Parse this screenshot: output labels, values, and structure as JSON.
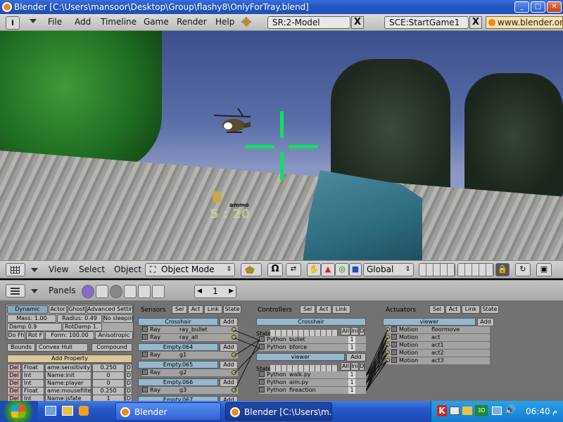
{
  "window": {
    "title": "Blender [C:\\Users\\mansoor\\Desktop\\Group\\flashy8\\OnlyForTray.blend]",
    "min_glyph": "_",
    "max_glyph": "□",
    "close_glyph": "✕"
  },
  "menu": {
    "items": [
      "File",
      "Add",
      "Timeline",
      "Game",
      "Render",
      "Help"
    ],
    "screen": "SR:2-Model",
    "scene": "SCE:StartGame1",
    "url": "www.blender.org",
    "close_glyph": "X"
  },
  "hud": {
    "ammo_label": "ammo",
    "ammo_value": "5 : 20"
  },
  "view_header": {
    "view": "View",
    "select": "Select",
    "object": "Object",
    "mode": "Object Mode",
    "orientation": "Global"
  },
  "buttons_header": {
    "panels": "Panels",
    "frame": "1"
  },
  "physics": {
    "tabs": [
      "Dynamic",
      "Actor",
      "Ghost",
      "Advanced Settings"
    ],
    "mass": "Mass: 1.00",
    "radius": "Radius: 0.49",
    "no_sleep": "No sleepin",
    "damp": "Damp 0.9",
    "rotdamp": "RotDamp 1.",
    "do_fh": "Do Fh",
    "rot_f": "Rot F",
    "form": "Form: 100.00",
    "aniso": "Anisotropic",
    "bounds": "Bounds",
    "bounds_type": "Convex Hull",
    "compound": "Compound",
    "add_property": "Add Property",
    "properties": [
      {
        "del": "Del",
        "type": "Float",
        "name": "ame:sensitivity",
        "value": "0.250",
        "d": "D"
      },
      {
        "del": "Del",
        "type": "Int",
        "name": "Name:init",
        "value": "0",
        "d": "D"
      },
      {
        "del": "Del",
        "type": "Int",
        "name": "Name:player",
        "value": "0",
        "d": "D"
      },
      {
        "del": "Del",
        "type": "Float",
        "name": "ame:mousefilter",
        "value": "0.250",
        "d": "D"
      },
      {
        "del": "Del",
        "type": "Int",
        "name": "Name:jsfate",
        "value": "1",
        "d": "D"
      }
    ]
  },
  "sensors": {
    "title": "Sensors",
    "filters": [
      "Sel",
      "Act",
      "Link",
      "State"
    ],
    "groups": [
      {
        "name": "Crosshair",
        "add": "Add",
        "rows": [
          {
            "type": "Ray",
            "name": "ray_bullet"
          },
          {
            "type": "Ray",
            "name": "ray_all"
          }
        ]
      },
      {
        "name": "Empty.064",
        "add": "Add",
        "rows": [
          {
            "type": "Ray",
            "name": "g1"
          }
        ]
      },
      {
        "name": "Empty.065",
        "add": "Add",
        "rows": [
          {
            "type": "Ray",
            "name": "g2"
          }
        ]
      },
      {
        "name": "Empty.066",
        "add": "Add",
        "rows": [
          {
            "type": "Ray",
            "name": "g3"
          }
        ]
      },
      {
        "name": "Empty.067",
        "add": "Add",
        "rows": []
      }
    ]
  },
  "controllers": {
    "title": "Controllers",
    "filters": [
      "Sel",
      "Act",
      "Link"
    ],
    "state_label": "State",
    "all": "All",
    "ini": "Ini",
    "d": "D",
    "groups": [
      {
        "name": "Crosshair",
        "rows": [
          {
            "type": "Python",
            "name": "bullet",
            "n": "1"
          },
          {
            "type": "Python",
            "name": "bforce",
            "n": "1"
          }
        ]
      },
      {
        "name": "viewer",
        "add": "Add",
        "rows": [
          {
            "type": "Python",
            "name": "walk.py",
            "n": "1"
          },
          {
            "type": "Python",
            "name": "aim.py",
            "n": "1"
          },
          {
            "type": "Python",
            "name": "fireaction",
            "n": "1"
          }
        ]
      }
    ]
  },
  "actuators": {
    "title": "Actuators",
    "filters": [
      "Sel",
      "Act",
      "Link",
      "State"
    ],
    "groups": [
      {
        "name": "viewer",
        "add": "Add",
        "rows": [
          {
            "type": "Motion",
            "name": "floormove"
          },
          {
            "type": "Motion",
            "name": "act"
          },
          {
            "type": "Motion",
            "name": "act1"
          },
          {
            "type": "Motion",
            "name": "act2"
          },
          {
            "type": "Motion",
            "name": "act3"
          }
        ]
      }
    ]
  },
  "taskbar": {
    "tasks": [
      "Blender",
      "Blender [C:\\Users\\m..."
    ],
    "clock": "06:40",
    "clock_suffix": "م",
    "tray_badge": "3D"
  },
  "colors": {
    "titlebar": "#2457c5",
    "crosshair": "#10e060",
    "taskbar": "#2658c9",
    "gun": "#2e6c80"
  }
}
